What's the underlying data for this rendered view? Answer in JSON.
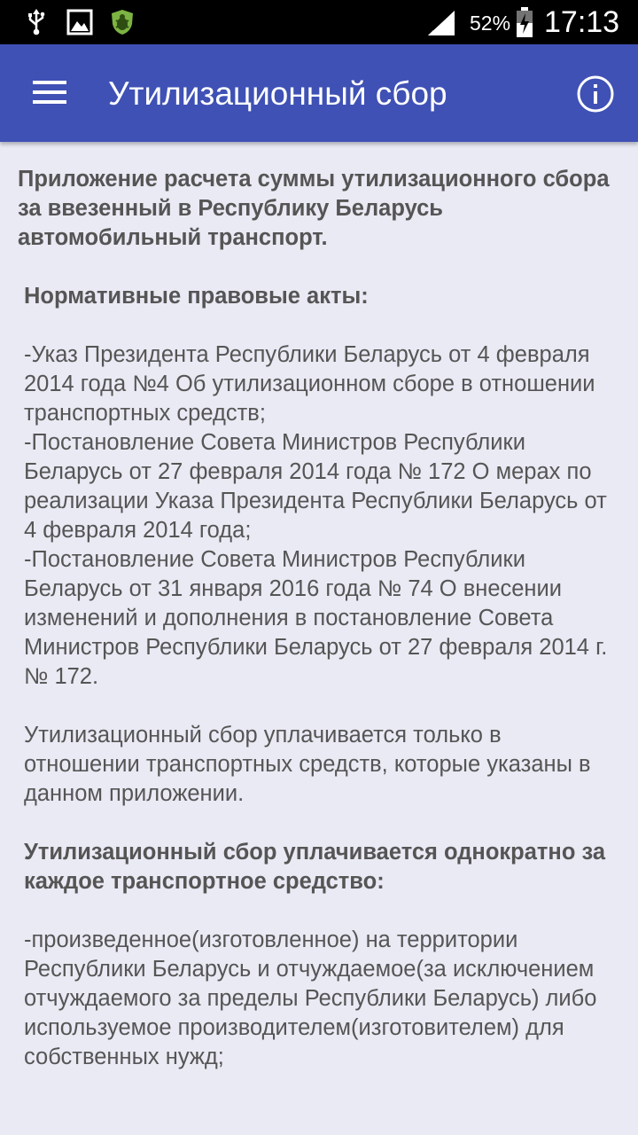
{
  "status_bar": {
    "icons": [
      "usb-icon",
      "image-notification-icon",
      "antivirus-bug-icon",
      "signal-icon",
      "battery-charging-icon"
    ],
    "battery": "52%",
    "time": "17:13"
  },
  "app_bar": {
    "title": "Утилизационный сбор",
    "menu_icon": "hamburger-menu-icon",
    "info_icon": "info-icon",
    "color": "#3f51b5"
  },
  "content": {
    "intro": "Приложение расчета суммы утилизационного сбора за ввезенный в Республику Беларусь автомобильный транспорт.",
    "acts_heading": "Нормативные правовые акты:",
    "acts": [
      "-Указ Президента Республики Беларусь от 4 февраля 2014 года №4 Об утилизационном сборе в отношении транспортных средств;",
      "-Постановление Совета Министров Республики Беларусь от 27 февраля 2014 года № 172 О мерах по реализации Указа Президента Республики Беларусь от 4 февраля 2014 года;",
      "-Постановление Совета Министров Республики Беларусь от 31 января 2016 года № 74 О внесении изменений и дополнения в постановление Совета Министров Республики Беларусь от 27 февраля 2014 г. № 172."
    ],
    "paid_note": "Утилизационный сбор уплачивается только в отношении транспортных средств, которые указаны в данном приложении.",
    "once_heading": "Утилизационный сбор уплачивается однократно за каждое транспортное средство:",
    "once_items": [
      "-произведенное(изготовленное) на территории Республики Беларусь и отчуждаемое(за исключением отчуждаемого за пределы Республики Беларусь) либо используемое производителем(изготовителем) для собственных нужд;"
    ]
  }
}
